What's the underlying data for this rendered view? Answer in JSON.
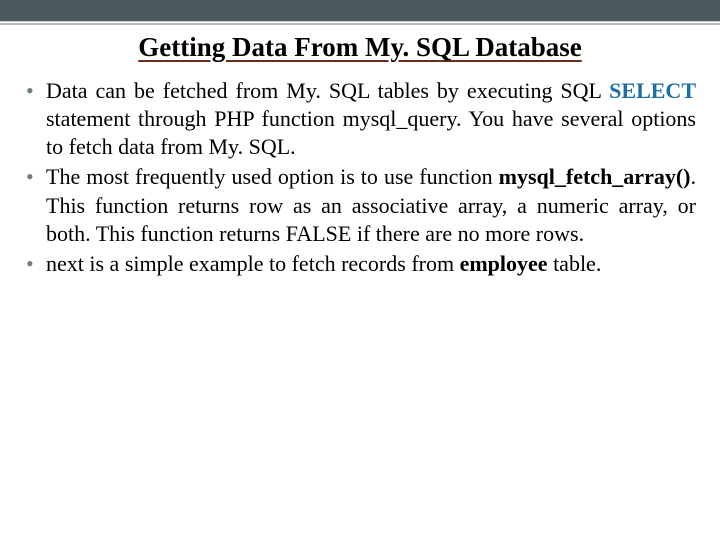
{
  "title": "Getting Data From My. SQL Database",
  "bullets": [
    {
      "pre": "Data can be fetched from My. SQL tables by executing SQL ",
      "kw": "SELECT",
      "post": " statement through PHP function mysql_query. You have several options to fetch data from My. SQL."
    },
    {
      "pre": "The most frequently used option is to use function ",
      "kw": "mysql_fetch_array()",
      "post": ". This function returns row as an associative array, a numeric array, or both. This function returns FALSE if there are no more rows."
    },
    {
      "pre": "next is a simple example to fetch records from ",
      "kw": "employee",
      "post": " table."
    }
  ]
}
